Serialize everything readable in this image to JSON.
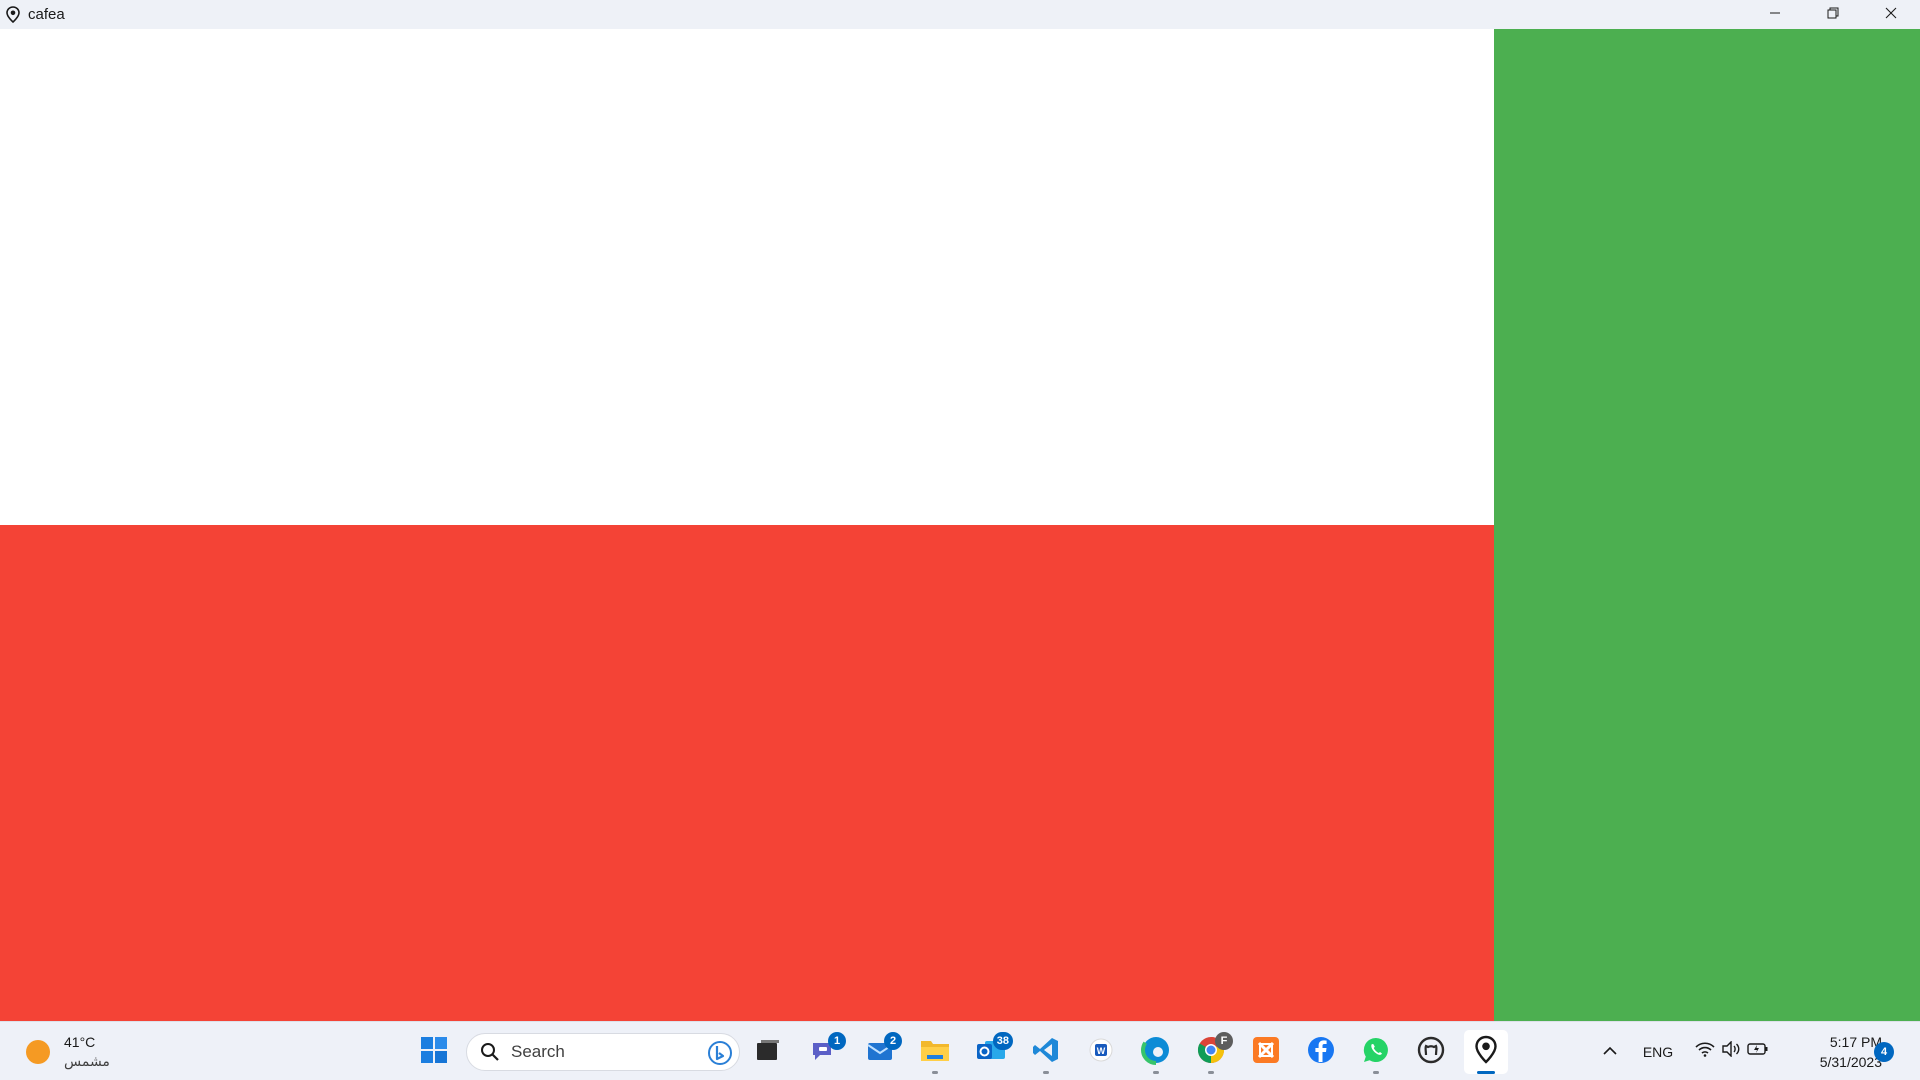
{
  "window": {
    "title": "cafea",
    "controls": [
      "minimize",
      "restore",
      "close"
    ]
  },
  "content": {
    "panels": [
      {
        "name": "top-left",
        "color": "#ffffff"
      },
      {
        "name": "bottom-left",
        "color": "#f44336"
      },
      {
        "name": "right",
        "color": "#4caf50"
      }
    ]
  },
  "taskbar": {
    "weather": {
      "temp": "41°C",
      "condition": "مشمس"
    },
    "search": {
      "placeholder": "Search"
    },
    "apps": [
      {
        "name": "start-button",
        "icon": "windows-logo-icon"
      },
      {
        "name": "task-view",
        "icon": "task-view-icon"
      },
      {
        "name": "teams",
        "icon": "teams-chat-icon",
        "badge": "1"
      },
      {
        "name": "mail",
        "icon": "mail-icon",
        "badge": "2"
      },
      {
        "name": "file-explorer",
        "icon": "folder-icon"
      },
      {
        "name": "outlook",
        "icon": "outlook-icon",
        "badge": "38"
      },
      {
        "name": "vscode",
        "icon": "vscode-icon"
      },
      {
        "name": "word",
        "icon": "word-icon"
      },
      {
        "name": "edge",
        "icon": "edge-icon"
      },
      {
        "name": "chrome",
        "icon": "chrome-icon",
        "badge": "F"
      },
      {
        "name": "xampp",
        "icon": "xampp-icon"
      },
      {
        "name": "facebook",
        "icon": "facebook-icon"
      },
      {
        "name": "whatsapp",
        "icon": "whatsapp-icon"
      },
      {
        "name": "github",
        "icon": "github-icon"
      },
      {
        "name": "cafea",
        "icon": "map-pin-icon"
      }
    ],
    "tray": {
      "language": "ENG",
      "time": "5:17 PM",
      "date": "5/31/2023",
      "notifications": "4"
    }
  }
}
